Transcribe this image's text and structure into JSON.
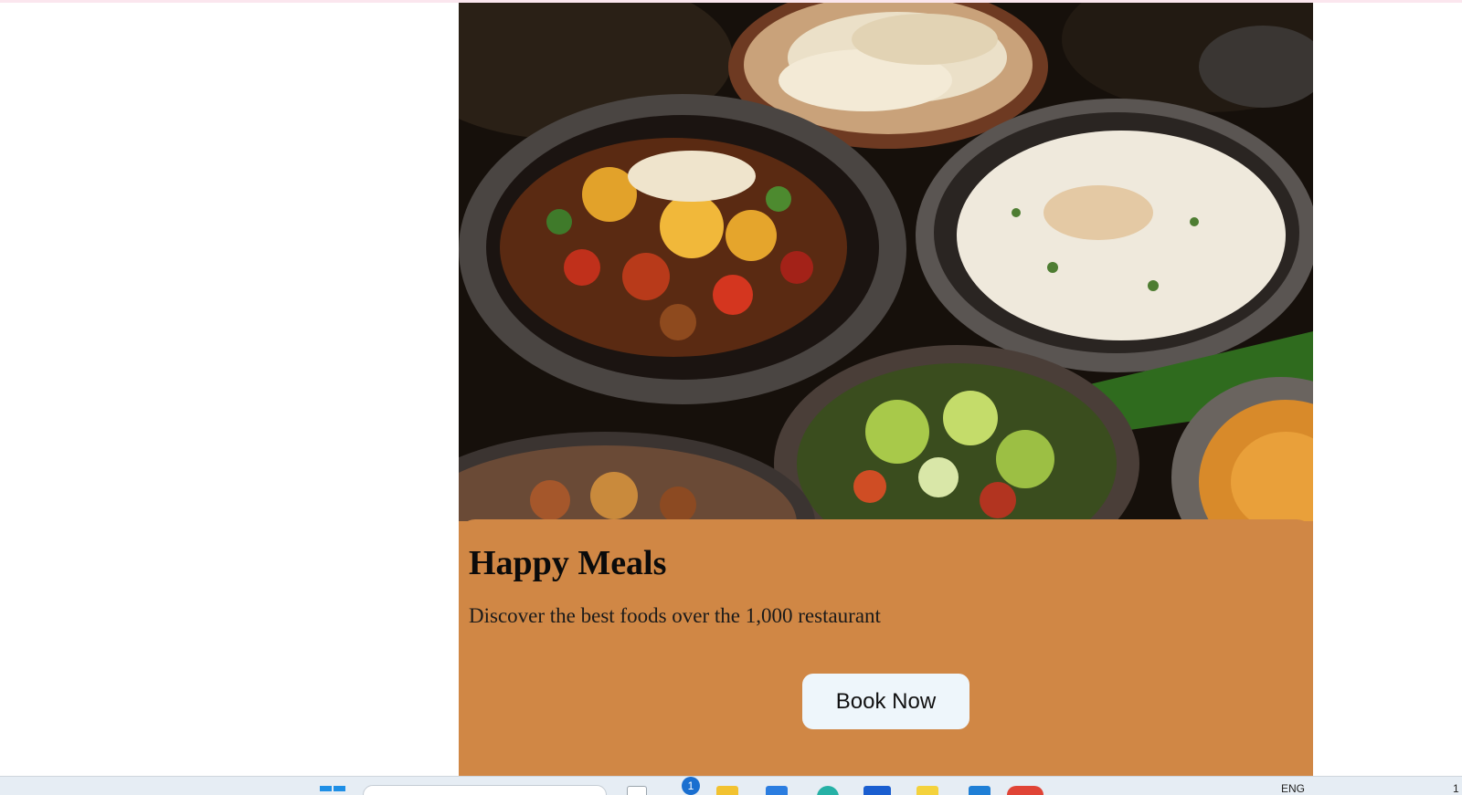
{
  "card": {
    "title": "Happy Meals",
    "subtitle": "Discover the best foods over the 1,000 restaurant",
    "book_button_label": "Book Now",
    "accent_color": "#d08745"
  },
  "image": {
    "icon": "food-platter-photo"
  },
  "taskbar": {
    "notification_count": "1",
    "language": "ENG",
    "clock_fragment": "1",
    "apps": [
      "windows-start-icon",
      "search-box",
      "task-view-icon",
      "file-explorer-icon",
      "store-icon",
      "edge-icon",
      "mail-icon",
      "sticky-notes-icon",
      "vscode-icon",
      "chrome-icon"
    ]
  }
}
